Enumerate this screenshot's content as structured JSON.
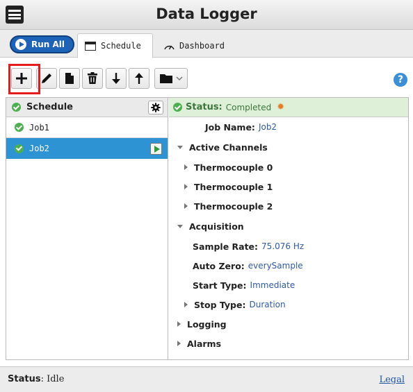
{
  "app": {
    "title": "Data Logger"
  },
  "tabs": {
    "run_all_label": "Run All",
    "items": [
      {
        "label": "Schedule",
        "icon": "calendar-icon",
        "active": true
      },
      {
        "label": "Dashboard",
        "icon": "gauge-icon",
        "active": false
      }
    ]
  },
  "toolbar": {
    "buttons": [
      "add-icon",
      "pencil-icon",
      "document-icon",
      "trash-icon",
      "arrow-down-icon",
      "arrow-up-icon",
      "folder-icon"
    ],
    "highlight_color": "#e41c1c"
  },
  "schedule": {
    "header": "Schedule",
    "jobs": [
      {
        "name": "Job1",
        "selected": false
      },
      {
        "name": "Job2",
        "selected": true
      }
    ]
  },
  "details": {
    "status_label": "Status:",
    "status_value": "Completed",
    "job_name_label": "Job Name:",
    "job_name_value": "Job2",
    "active_channels_label": "Active Channels",
    "channels": [
      "Thermocouple 0",
      "Thermocouple 1",
      "Thermocouple 2"
    ],
    "acquisition_label": "Acquisition",
    "sample_rate_label": "Sample Rate:",
    "sample_rate_value": "75.076 Hz",
    "auto_zero_label": "Auto Zero:",
    "auto_zero_value": "everySample",
    "start_type_label": "Start Type:",
    "start_type_value": "Immediate",
    "stop_type_label": "Stop Type:",
    "stop_type_value": "Duration",
    "logging_label": "Logging",
    "alarms_label": "Alarms"
  },
  "footer": {
    "status_label": "Status",
    "status_value": ": Idle",
    "legal_label": "Legal"
  },
  "colors": {
    "accent": "#2e93d3",
    "run_all": "#1d63b8",
    "status_ok": "#4caf50",
    "value_text": "#2e5aa8"
  }
}
